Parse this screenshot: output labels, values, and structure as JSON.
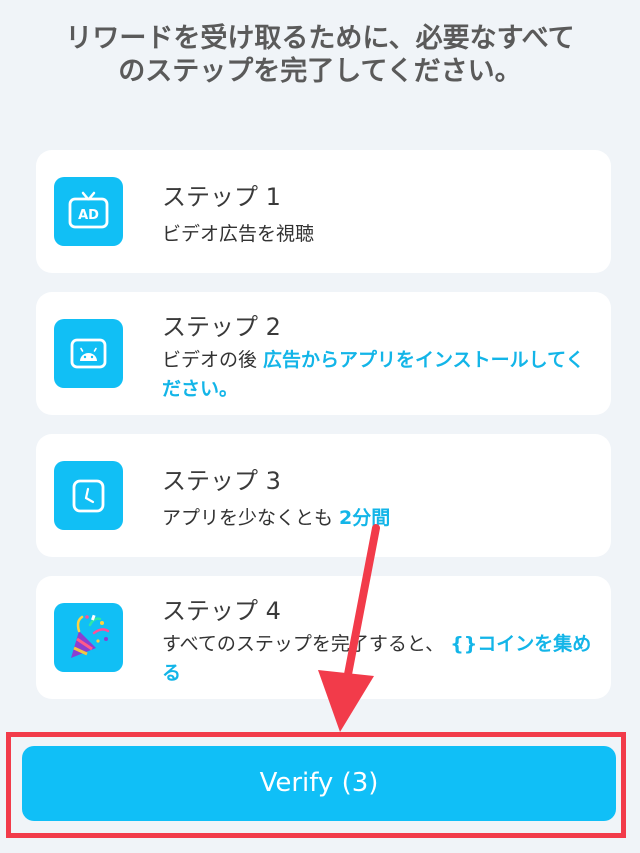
{
  "heading": "リワードを受け取るために、必要なすべてのステップを完了してください。",
  "steps": [
    {
      "title": "ステップ 1",
      "desc_plain": "ビデオ広告を視聴",
      "icon": "ad-tv-icon"
    },
    {
      "title": "ステップ 2",
      "desc_plain": "ビデオの後 ",
      "desc_highlight": "広告からアプリをインストールしてください。",
      "icon": "android-icon"
    },
    {
      "title": "ステップ 3",
      "desc_plain": "アプリを少なくとも ",
      "desc_highlight": "2分間",
      "icon": "clock-icon"
    },
    {
      "title": "ステップ 4",
      "desc_plain": "すべてのステップを完了すると、 ",
      "desc_highlight": "{}コインを集める",
      "icon": "party-popper-icon"
    }
  ],
  "verify_label": "Verify (3)",
  "colors": {
    "accent": "#11bff5",
    "highlight_text": "#13b5e8",
    "annotation_red": "#f23b4a",
    "background": "#f0f4f8"
  }
}
